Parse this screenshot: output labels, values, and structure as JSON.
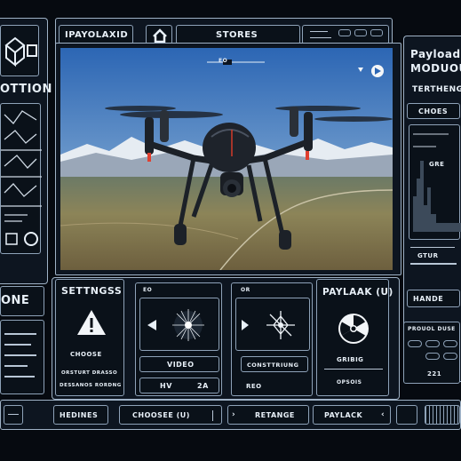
{
  "colors": {
    "bezel": "#060a10",
    "panel": "#0d1520",
    "border": "#9fb2c6",
    "sky_top": "#2c66b4",
    "sky_bottom": "#a9c4dc",
    "ground": "#7a7554"
  },
  "top_bar": {
    "app_tag": "IPAYOLAXID",
    "home_icon": "home-icon",
    "stores_label": "STORES"
  },
  "left_panel": {
    "title": "OTTION",
    "bottom_label": "ONE"
  },
  "video": {
    "hud_label": "EO"
  },
  "right_panel": {
    "title_line1": "Payload",
    "title_line2": "MODUOU",
    "subtitle": "TERTHENG",
    "choices_button": "CHOES",
    "graph_label": "GRE",
    "field_label": "GTUR",
    "handle_button": "HANDE",
    "mini_title": "PROUOL DUSE",
    "footer": "221"
  },
  "settings_panel": {
    "title": "SETTNGSS",
    "warning_icon": "warning-icon",
    "choose_label": "CHOOSE",
    "line1": "ORSTURT DRASSO",
    "line2": "DESSANOS RORDNG"
  },
  "video_panel": {
    "top_label": "EO",
    "play_icon": "play-left-icon",
    "video_label": "VIDEO",
    "hv_left": "HV",
    "hv_right": "2A"
  },
  "compass_panel": {
    "top_label": "OR",
    "constr_label": "CONSTTRIUNG",
    "reo_label": "REO"
  },
  "payload_panel": {
    "title": "PAYLAAK (U)",
    "radiation_icon": "radiation-icon",
    "label": "GRIBIG",
    "sub": "OPSOIS"
  },
  "bottom_bar": {
    "hedines": "HEDINES",
    "choose": "CHOOSEE (U)",
    "retange": "RETANGE",
    "paylack": "PAYLACK"
  }
}
